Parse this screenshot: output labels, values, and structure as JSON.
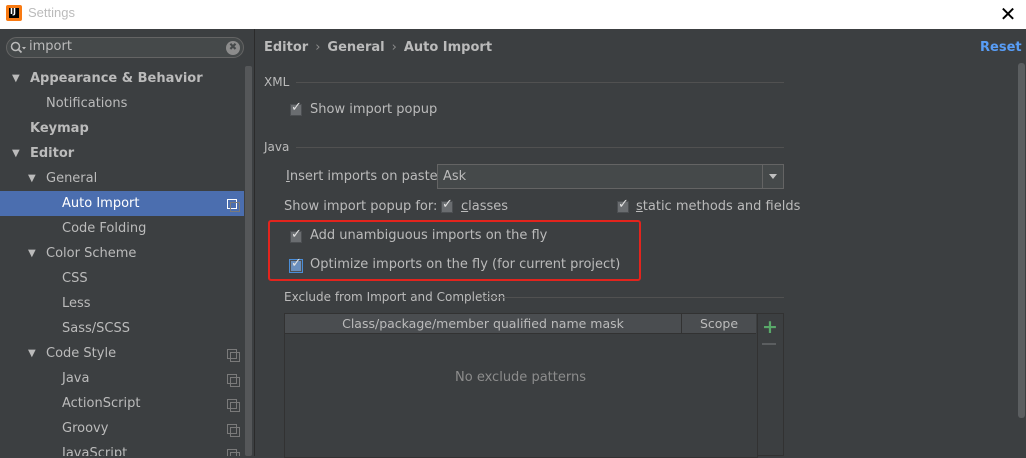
{
  "window": {
    "title": "Settings",
    "close_glyph": "✕"
  },
  "sidebar": {
    "search": {
      "value": "import",
      "clear_glyph": "✖"
    },
    "items": [
      {
        "label": "Appearance & Behavior",
        "arrow": "▼"
      },
      {
        "label": "Notifications"
      },
      {
        "label": "Keymap"
      },
      {
        "label": "Editor",
        "arrow": "▼"
      },
      {
        "label": "General",
        "arrow": "▼"
      },
      {
        "label": "Auto Import"
      },
      {
        "label": "Code Folding"
      },
      {
        "label": "Color Scheme",
        "arrow": "▼"
      },
      {
        "label": "CSS"
      },
      {
        "label": "Less"
      },
      {
        "label": "Sass/SCSS"
      },
      {
        "label": "Code Style",
        "arrow": "▼"
      },
      {
        "label": "Java"
      },
      {
        "label": "ActionScript"
      },
      {
        "label": "Groovy"
      },
      {
        "label": "JavaScript"
      }
    ]
  },
  "header": {
    "breadcrumb": [
      "Editor",
      "General",
      "Auto Import"
    ],
    "sep": "›",
    "reset": "Reset"
  },
  "xml": {
    "section": "XML",
    "show_import_popup": "Show import popup"
  },
  "java": {
    "section": "Java",
    "insert_label_u": "I",
    "insert_label_rest": "nsert imports on paste:",
    "insert_value": "Ask",
    "show_popup_for": "Show import popup for:",
    "classes_u": "c",
    "classes_rest": "lasses",
    "static_u": "s",
    "static_rest": "tatic methods and fields",
    "add_unambiguous": "Add unambiguous imports on the fly",
    "optimize": "Optimize imports on the fly (for current project)"
  },
  "exclude": {
    "section": "Exclude from Import and Completion",
    "col1": "Class/package/member qualified name mask",
    "col2": "Scope",
    "empty": "No exclude patterns",
    "add": "+"
  },
  "colors": {
    "accent": "#4b6eaf",
    "link": "#589df6",
    "highlight": "#e3241d",
    "add": "#59a869"
  }
}
